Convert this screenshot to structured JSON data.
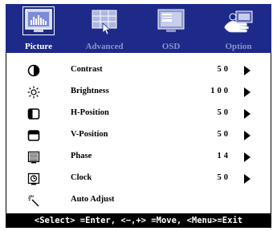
{
  "tabs": [
    {
      "label": "Picture",
      "icon": "picture-icon",
      "active": true
    },
    {
      "label": "Advanced",
      "icon": "advanced-icon",
      "active": false
    },
    {
      "label": "OSD",
      "icon": "osd-icon",
      "active": false
    },
    {
      "label": "Option",
      "icon": "option-hand-icon",
      "active": false
    }
  ],
  "items": [
    {
      "label": "Contrast",
      "value": "50",
      "icon": "contrast-icon",
      "arrow": true
    },
    {
      "label": "Brightness",
      "value": "100",
      "icon": "brightness-sun-icon",
      "arrow": true
    },
    {
      "label": "H-Position",
      "value": "50",
      "icon": "h-position-icon",
      "arrow": true
    },
    {
      "label": "V-Position",
      "value": "50",
      "icon": "v-position-icon",
      "arrow": true
    },
    {
      "label": "Phase",
      "value": "14",
      "icon": "phase-icon",
      "arrow": true
    },
    {
      "label": "Clock",
      "value": "50",
      "icon": "clock-icon",
      "arrow": true
    },
    {
      "label": "Auto Adjust",
      "value": "",
      "icon": "auto-adjust-wand-icon",
      "arrow": false
    }
  ],
  "status_bar": "<Select> =Enter, <−,+> =Move, <Menu>=Exit",
  "colors": {
    "tab_bar": "#1d2a8a",
    "active_label": "#ffffff",
    "inactive_label": "#8a93c7",
    "status_bg": "#000000"
  }
}
